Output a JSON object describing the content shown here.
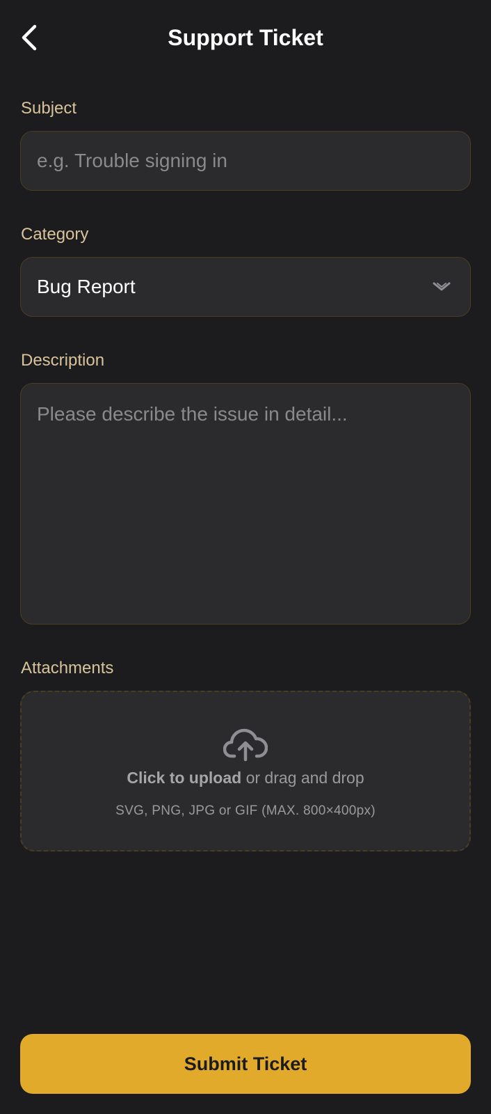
{
  "header": {
    "title": "Support Ticket",
    "back_icon": "chevron-left-icon"
  },
  "form": {
    "subject": {
      "label": "Subject",
      "placeholder": "e.g. Trouble signing in",
      "value": ""
    },
    "category": {
      "label": "Category",
      "selected": "Bug Report",
      "icon": "chevron-down-icon"
    },
    "description": {
      "label": "Description",
      "placeholder": "Please describe the issue in detail...",
      "value": ""
    },
    "attachments": {
      "label": "Attachments",
      "icon": "cloud-upload-icon",
      "upload_action": "Click to upload",
      "upload_suffix": "or drag and drop",
      "hint": "SVG, PNG, JPG or GIF (MAX. 800×400px)"
    }
  },
  "submit_label": "Submit Ticket",
  "colors": {
    "background": "#1c1c1e",
    "field": "#2b2b2d",
    "field_border": "#4a3e22",
    "label": "#d8c39a",
    "accent": "#e2aa2a"
  }
}
